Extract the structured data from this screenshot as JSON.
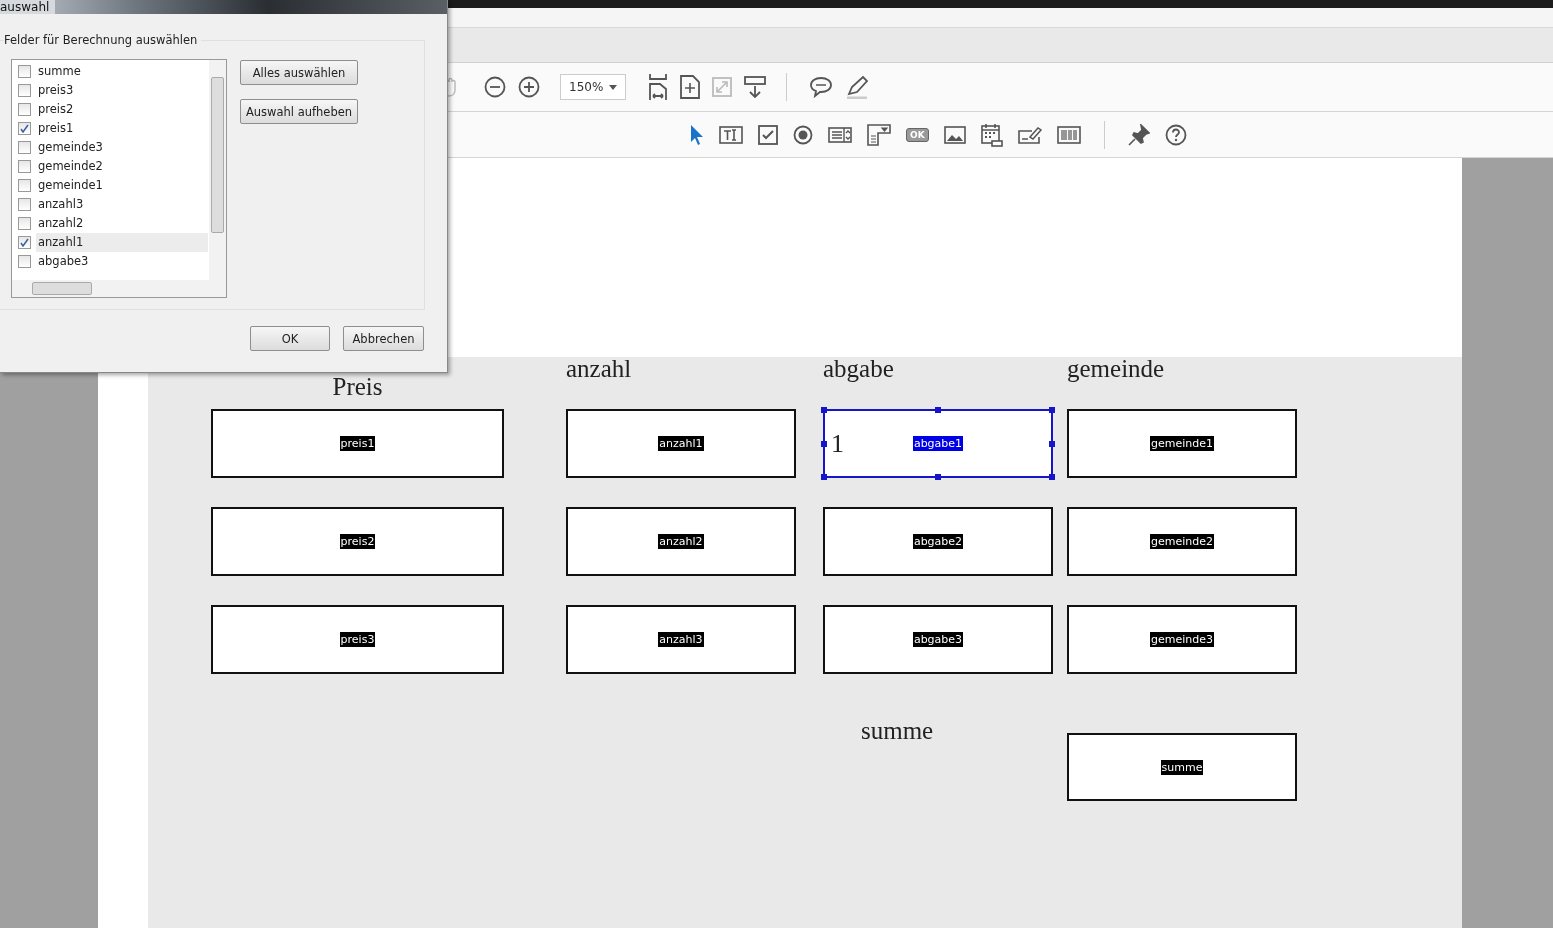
{
  "dialog": {
    "title": "auswahl",
    "group_label": "Felder für Berechnung auswählen",
    "fields": [
      {
        "label": "summe",
        "checked": false,
        "selected": false
      },
      {
        "label": "preis3",
        "checked": false,
        "selected": false
      },
      {
        "label": "preis2",
        "checked": false,
        "selected": false
      },
      {
        "label": "preis1",
        "checked": true,
        "selected": false
      },
      {
        "label": "gemeinde3",
        "checked": false,
        "selected": false
      },
      {
        "label": "gemeinde2",
        "checked": false,
        "selected": false
      },
      {
        "label": "gemeinde1",
        "checked": false,
        "selected": false
      },
      {
        "label": "anzahl3",
        "checked": false,
        "selected": false
      },
      {
        "label": "anzahl2",
        "checked": false,
        "selected": false
      },
      {
        "label": "anzahl1",
        "checked": true,
        "selected": true
      },
      {
        "label": "abgabe3",
        "checked": false,
        "selected": false
      }
    ],
    "side_buttons": [
      "Alles auswählen",
      "Auswahl aufheben"
    ],
    "buttons": [
      "OK",
      "Abbrechen"
    ]
  },
  "toolbar": {
    "zoom": "150%",
    "button_tool_label": "OK"
  },
  "form": {
    "columns": [
      {
        "header": "Preis",
        "fields": [
          {
            "label": "preis1",
            "selected": false
          },
          {
            "label": "preis2",
            "selected": false
          },
          {
            "label": "preis3",
            "selected": false
          }
        ]
      },
      {
        "header": "anzahl",
        "fields": [
          {
            "label": "anzahl1",
            "selected": false
          },
          {
            "label": "anzahl2",
            "selected": false
          },
          {
            "label": "anzahl3",
            "selected": false
          }
        ]
      },
      {
        "header": "abgabe",
        "fields": [
          {
            "label": "abgabe1",
            "value": "1",
            "selected": true
          },
          {
            "label": "abgabe2",
            "selected": false
          },
          {
            "label": "abgabe3",
            "selected": false
          }
        ]
      },
      {
        "header": "gemeinde",
        "fields": [
          {
            "label": "gemeinde1",
            "selected": false
          },
          {
            "label": "gemeinde2",
            "selected": false
          },
          {
            "label": "gemeinde3",
            "selected": false
          }
        ]
      }
    ],
    "total": {
      "label": "summe",
      "field": {
        "label": "summe",
        "selected": false
      }
    }
  }
}
